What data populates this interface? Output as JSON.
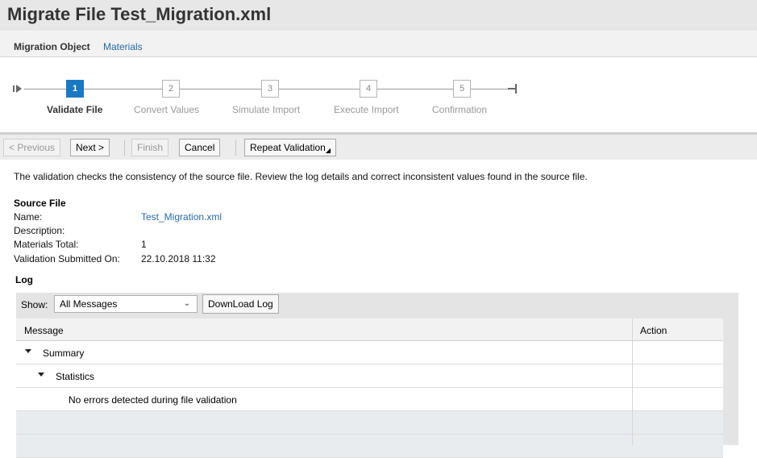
{
  "page": {
    "title": "Migrate File Test_Migration.xml"
  },
  "migration_object": {
    "label": "Migration Object",
    "value": "Materials"
  },
  "roadmap": {
    "steps": [
      {
        "number": "1",
        "label": "Validate File",
        "active": true
      },
      {
        "number": "2",
        "label": "Convert Values",
        "active": false
      },
      {
        "number": "3",
        "label": "Simulate Import",
        "active": false
      },
      {
        "number": "4",
        "label": "Execute Import",
        "active": false
      },
      {
        "number": "5",
        "label": "Confirmation",
        "active": false
      }
    ]
  },
  "toolbar": {
    "previous": "< Previous",
    "next": "Next >",
    "finish": "Finish",
    "cancel": "Cancel",
    "repeat_validation": "Repeat Validation"
  },
  "description": "The validation checks the consistency of the source file. Review the log details and correct inconsistent values found in the source file.",
  "source_file": {
    "title": "Source File",
    "name_label": "Name:",
    "name_value": "Test_Migration.xml",
    "description_label": "Description:",
    "description_value": "",
    "materials_total_label": "Materials Total:",
    "materials_total_value": "1",
    "submitted_label": "Validation Submitted On:",
    "submitted_value": "22.10.2018 11:32"
  },
  "log": {
    "title": "Log",
    "show_label": "Show:",
    "show_selected": "All Messages",
    "download_label": "DownLoad Log",
    "columns": {
      "message": "Message",
      "action": "Action"
    },
    "rows": [
      {
        "text": "Summary",
        "level": 0,
        "expandable": true
      },
      {
        "text": "Statistics",
        "level": 1,
        "expandable": true
      },
      {
        "text": "No errors detected during file validation",
        "level": 2,
        "expandable": false
      }
    ]
  },
  "colors": {
    "accent": "#1a78c2",
    "link": "#2a6aa8",
    "title_bar": "#e7e7e7"
  }
}
